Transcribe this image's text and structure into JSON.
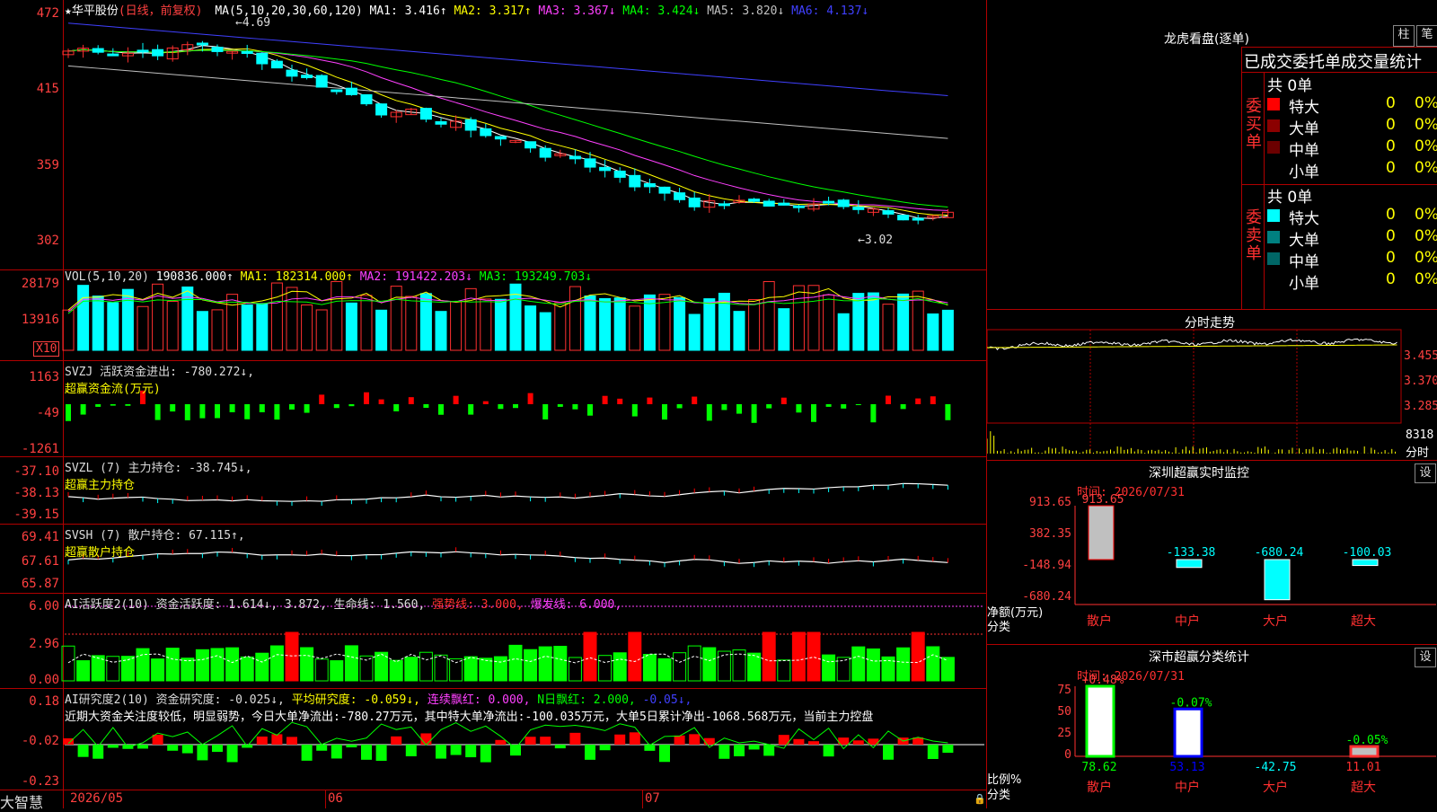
{
  "kline": {
    "name": "华平股份",
    "period": "(日线，前复权)",
    "ma_label": "MA(5,10,20,30,60,120)",
    "ma_values": [
      {
        "t": "MA1: 3.416↑",
        "c": "#ffffff"
      },
      {
        "t": "MA2: 3.317↑",
        "c": "#ffff00"
      },
      {
        "t": "MA3: 3.367↓",
        "c": "#ff40ff"
      },
      {
        "t": "MA4: 3.424↓",
        "c": "#00ff00"
      },
      {
        "t": "MA5: 3.820↓",
        "c": "#c0c0c0"
      },
      {
        "t": "MA6: 4.137↓",
        "c": "#4040ff"
      }
    ],
    "y_labels": [
      "472",
      "415",
      "359",
      "302"
    ],
    "high_mark": "4.69",
    "low_mark": "3.02",
    "colors": {
      "up": "#ff3030",
      "down": "#00ffff"
    }
  },
  "vol": {
    "title": "VOL(5,10,20)",
    "values": [
      {
        "t": "190836.000↑",
        "c": "#ffffff"
      },
      {
        "t": "MA1: 182314.000↑",
        "c": "#ffff00"
      },
      {
        "t": "MA2: 191422.203↓",
        "c": "#ff40ff"
      },
      {
        "t": "MA3: 193249.703↓",
        "c": "#00ff00"
      }
    ],
    "y_labels": [
      "28179",
      "13916"
    ],
    "unit": "X10"
  },
  "svzj": {
    "title": "SVZJ 活跃资金进出: -780.272↓,",
    "subtitle": "超赢资金流(万元)",
    "y_labels": [
      "1163",
      "-49",
      "-1261"
    ]
  },
  "svzl": {
    "title": "SVZL (7) 主力持仓: -38.745↓,",
    "subtitle": "超赢主力持仓",
    "y_labels": [
      "-37.10",
      "-38.13",
      "-39.15"
    ]
  },
  "svsh": {
    "title": "SVSH (7) 散户持仓: 67.115↑,",
    "subtitle": "超赢散户持仓",
    "y_labels": [
      "69.41",
      "67.61",
      "65.87"
    ]
  },
  "ai_active": {
    "title": "AI活跃度2(10) 资金活跃度: 1.614↓, 3.872, 生命线: 1.560,",
    "strong": "强势线: 3.000,",
    "burst": "爆发线: 6.000,",
    "y_labels": [
      "6.00",
      "2.96",
      "0.00"
    ]
  },
  "ai_research": {
    "title": "AI研究度2(10) 资金研究度: -0.025↓,",
    "avg": "平均研究度: -0.059↓,",
    "red": "连续飘红: 0.000,",
    "nred": "N日飘红: 2.000,",
    "tail": "-0.05↓,",
    "comment": "近期大资金关注度较低，明显弱势，今日大单净流出:-780.27万元，其中特大单净流出:-100.035万元，大单5日累计净出-1068.568万元，当前主力控盘",
    "y_labels": [
      "0.18",
      "-0.02",
      "-0.23"
    ]
  },
  "bottom": {
    "brand": "大智慧",
    "dates": [
      "2026/05",
      "06",
      "07"
    ]
  },
  "lhb": {
    "title": "龙虎看盘(逐单)",
    "btn1": "柱",
    "btn2": "笔",
    "header": "已成交委托单成交量统计",
    "buy_side": "委买单",
    "sell_side": "委卖单",
    "buy_total": "共 0单",
    "sell_total": "共 0单",
    "buy_rows": [
      {
        "label": "特大",
        "v": "0",
        "p": "0%",
        "c": "#ff0000"
      },
      {
        "label": "大单",
        "v": "0",
        "p": "0%",
        "c": "#8b0000"
      },
      {
        "label": "中单",
        "v": "0",
        "p": "0%",
        "c": "#6b0000"
      },
      {
        "label": "小单",
        "v": "0",
        "p": "0%",
        "c": "#000000"
      }
    ],
    "sell_rows": [
      {
        "label": "特大",
        "v": "0",
        "p": "0%",
        "c": "#00ffff"
      },
      {
        "label": "大单",
        "v": "0",
        "p": "0%",
        "c": "#008080"
      },
      {
        "label": "中单",
        "v": "0",
        "p": "0%",
        "c": "#006666"
      },
      {
        "label": "小单",
        "v": "0",
        "p": "0%",
        "c": "#000000"
      }
    ]
  },
  "intraday": {
    "title": "分时走势",
    "y_labels": [
      "3.455",
      "3.370",
      "3.285"
    ],
    "vol_label": "8318",
    "vol_unit": "分时"
  },
  "monitor": {
    "title": "深圳超赢实时监控",
    "btn": "设",
    "time": "时间: 2026/07/31",
    "y_labels": [
      "913.65",
      "382.35",
      "-148.94",
      "-680.24"
    ],
    "unit": "净额(万元)",
    "cat": "分类",
    "bars": [
      {
        "label": "散户",
        "v": 913.65,
        "t": "913.65"
      },
      {
        "label": "中户",
        "v": -133.38,
        "t": "-133.38"
      },
      {
        "label": "大户",
        "v": -680.24,
        "t": "-680.24"
      },
      {
        "label": "超大",
        "v": -100.03,
        "t": "-100.03"
      }
    ]
  },
  "classify": {
    "title": "深市超赢分类统计",
    "btn": "设",
    "time": "时间: 2026/07/31",
    "y_labels": [
      "75",
      "50",
      "25",
      "0"
    ],
    "unit": "比例%",
    "cat": "分类",
    "bars": [
      {
        "label": "散户",
        "v": 78.62,
        "top": "+0.48%",
        "val": "78.62",
        "c": "#00ff00"
      },
      {
        "label": "中户",
        "v": 53.13,
        "top": "-0.07%",
        "val": "53.13",
        "c": "#0000ff"
      },
      {
        "label": "大户",
        "v": 0,
        "top": "",
        "val": "-42.75",
        "c": "#00ffff"
      },
      {
        "label": "超大",
        "v": 11.01,
        "top": "-0.05%",
        "val": "11.01",
        "c": "#ff3030"
      }
    ]
  },
  "chart_data": {
    "type": "bar",
    "title": "深市超赢分类统计",
    "categories": [
      "散户",
      "中户",
      "大户",
      "超大"
    ],
    "series": [
      {
        "name": "比例%",
        "values": [
          78.62,
          53.13,
          -42.75,
          11.01
        ]
      }
    ]
  }
}
